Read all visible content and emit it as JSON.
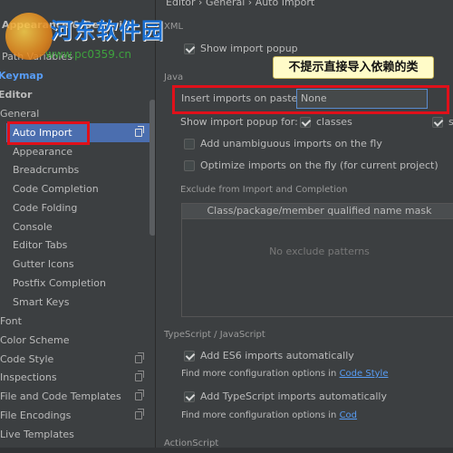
{
  "watermark": {
    "title": "河东软件园",
    "url": "www.pc0359.cn"
  },
  "sidebar": {
    "items": [
      {
        "label": "Appearance & Behavior",
        "style": "bold"
      },
      {
        "label": "Path Variables",
        "style": "normal"
      },
      {
        "label": "Keymap",
        "style": "keymap"
      },
      {
        "label": "Editor",
        "style": "bold"
      },
      {
        "label": "General",
        "style": "normal"
      },
      {
        "label": "Auto Import",
        "style": "selected",
        "copy_icon": true
      },
      {
        "label": "Appearance",
        "style": "normal"
      },
      {
        "label": "Breadcrumbs",
        "style": "normal"
      },
      {
        "label": "Code Completion",
        "style": "normal"
      },
      {
        "label": "Code Folding",
        "style": "normal"
      },
      {
        "label": "Console",
        "style": "normal"
      },
      {
        "label": "Editor Tabs",
        "style": "normal"
      },
      {
        "label": "Gutter Icons",
        "style": "normal"
      },
      {
        "label": "Postfix Completion",
        "style": "normal"
      },
      {
        "label": "Smart Keys",
        "style": "normal"
      },
      {
        "label": "Font",
        "style": "normal"
      },
      {
        "label": "Color Scheme",
        "style": "normal"
      },
      {
        "label": "Code Style",
        "style": "normal",
        "copy_icon": true
      },
      {
        "label": "Inspections",
        "style": "normal",
        "copy_icon": true
      },
      {
        "label": "File and Code Templates",
        "style": "normal",
        "copy_icon": true
      },
      {
        "label": "File Encodings",
        "style": "normal",
        "copy_icon": true
      },
      {
        "label": "Live Templates",
        "style": "normal"
      }
    ]
  },
  "breadcrumb": "Editor › General › Auto Import",
  "xml": {
    "section": "XML",
    "show_import_popup": "Show import popup"
  },
  "java": {
    "section": "Java",
    "insert_imports_label": "Insert imports on paste:",
    "insert_imports_value": "None",
    "show_popup_label": "Show import popup for:",
    "classes_label": "classes",
    "static_label": "st",
    "add_unambiguous": "Add unambiguous imports on the fly",
    "optimize_imports": "Optimize imports on the fly (for current project)"
  },
  "exclude": {
    "section": "Exclude from Import and Completion",
    "column_header": "Class/package/member qualified name mask",
    "empty_text": "No exclude patterns"
  },
  "typescript": {
    "section": "TypeScript / JavaScript",
    "add_es6": "Add ES6 imports automatically",
    "find_more_1_prefix": "Find more configuration options in",
    "find_more_1_link": "Code Style",
    "add_ts": "Add TypeScript imports automatically",
    "find_more_2_prefix": "Find more configuration options in",
    "find_more_2_link": "Cod"
  },
  "actionscript": {
    "section": "ActionScript"
  },
  "callout": "不提示直接导入依赖的类",
  "colors": {
    "background": "#3c3f41",
    "selection": "#4b6eaf",
    "highlight_red": "#e0101a",
    "link_blue": "#589df6"
  }
}
